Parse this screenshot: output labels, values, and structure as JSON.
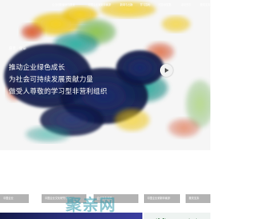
{
  "nav": {
    "items": [
      "企业创新使命与愿景",
      "中国企业家新年献辞",
      "新闻与出版",
      "学习园地",
      "可持续发展",
      "活动日历",
      "服务支持"
    ]
  },
  "hero": {
    "tagline": "愿景 · 使命",
    "headline_lines": [
      "推动企业绿色成长",
      "为社会可持续发展贡献力量",
      "做受人尊敬的学习型非营利组织"
    ],
    "play_icon": "play-icon"
  },
  "tabs": [
    "中国企业",
    "中国企业文化研究中心",
    "企业社会责任",
    "中国企业家新年献辞",
    "服务支持"
  ],
  "watermark": "聚亲网",
  "colors": {
    "tab_bg": "#b3b3b3",
    "banner_dark": "#1e2563",
    "hero_bg": "#f6f6f6"
  }
}
